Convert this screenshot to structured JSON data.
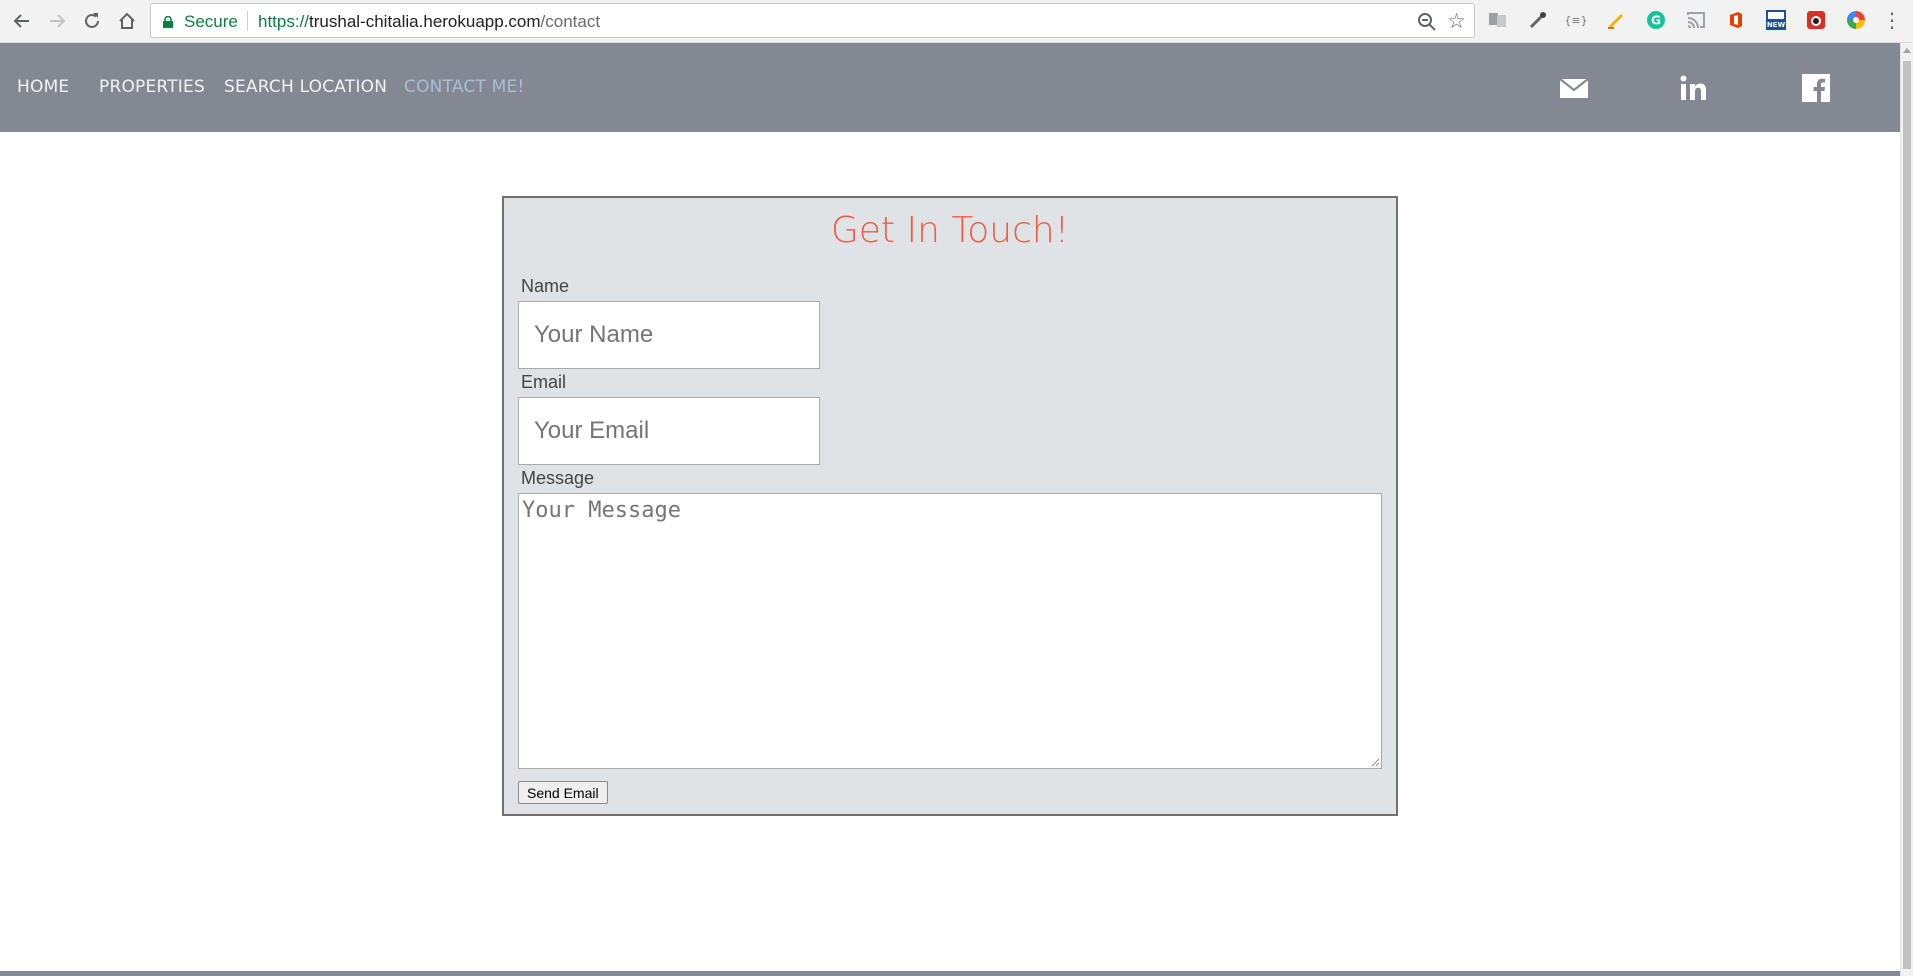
{
  "browser": {
    "secure_label": "Secure",
    "url_scheme": "https://",
    "url_host": "trushal-chitalia.herokuapp.com",
    "url_path": "/contact",
    "icons": [
      "back-arrow-icon",
      "forward-arrow-icon",
      "reload-icon",
      "home-icon",
      "lock-icon",
      "zoom-icon",
      "star-icon",
      "menu-kebab-icon"
    ],
    "extensions": [
      "translate-extension-icon",
      "eyedropper-extension-icon",
      "json-extension-icon",
      "note-extension-icon",
      "grammarly-extension-icon",
      "cast-extension-icon",
      "office-extension-icon",
      "news-extension-icon",
      "ladybug-extension-icon",
      "color-wheel-extension-icon"
    ],
    "json_ext_text": "{≡}",
    "news_ext_text": "NEW"
  },
  "navbar": {
    "links": [
      {
        "label": "Home",
        "active": false
      },
      {
        "label": "Properties",
        "active": false
      },
      {
        "label": "Search Location",
        "active": false
      },
      {
        "label": "Contact Me!",
        "active": true
      }
    ],
    "social_icons": [
      "email-icon",
      "linkedin-icon",
      "facebook-icon"
    ]
  },
  "form": {
    "title": "Get In Touch!",
    "name_label": "Name",
    "name_placeholder": "Your Name",
    "email_label": "Email",
    "email_placeholder": "Your Email",
    "message_label": "Message",
    "message_placeholder": "Your Message",
    "submit_label": "Send Email"
  },
  "colors": {
    "navbar_bg": "#848892",
    "nav_link": "#f2f2f2",
    "nav_link_active": "#a7bfd6",
    "form_bg": "#dfe3e6",
    "title": "#ef5b42",
    "secure_green": "#0b8043"
  }
}
